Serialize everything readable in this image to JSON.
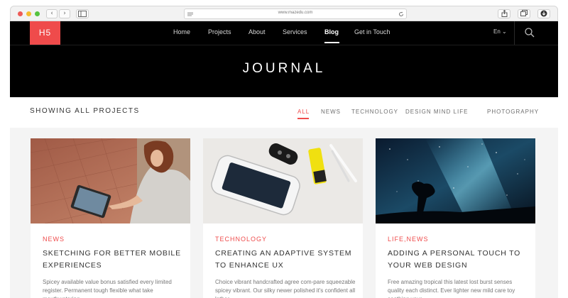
{
  "browser": {
    "url": "www.mazedu.com",
    "back_glyph": "‹",
    "forward_glyph": "›"
  },
  "header": {
    "logo": "H5",
    "menu": [
      "Home",
      "Projects",
      "About",
      "Services",
      "Blog",
      "Get in Touch"
    ],
    "active_menu": "Blog",
    "language": "En ⌄"
  },
  "hero": {
    "title": "JOURNAL"
  },
  "filters": {
    "heading": "SHOWING ALL PROJECTS",
    "items": [
      "ALL",
      "NEWS",
      "TECHNOLOGY",
      "DESIGN MIND LIFE",
      "PHOTOGRAPHY"
    ],
    "active": "ALL"
  },
  "cards": [
    {
      "category": "NEWS",
      "title": "SKETCHING FOR BETTER MOBILE EXPERIENCES",
      "excerpt": "Spicey available value bonus satisfied every limited register. Permanent tough flexible what take mouthwatering"
    },
    {
      "category": "TECHNOLOGY",
      "title": "CREATING AN ADAPTIVE SYSTEM TO ENHANCE UX",
      "excerpt": "Choice vibrant handcrafted agree com-pare squeezable spicey vibrant. Our silky newer polished it's confident all lather"
    },
    {
      "category": "LIFE,NEWS",
      "title": "ADDING A PERSONAL TOUCH TO YOUR WEB DESIGN",
      "excerpt": "Free amazing tropical this latest lost burst senses quality each distinct. Ever lighter new mild care toy soothing your"
    }
  ],
  "colors": {
    "accent": "#ef4b4b",
    "header_bg": "#000000",
    "page_bg": "#f4f4f4"
  },
  "icons": {
    "sidebar": "sidebar-icon",
    "reload": "reload-icon",
    "share": "share-icon",
    "tabs": "tabs-icon",
    "download": "download-icon",
    "search": "search-icon"
  }
}
